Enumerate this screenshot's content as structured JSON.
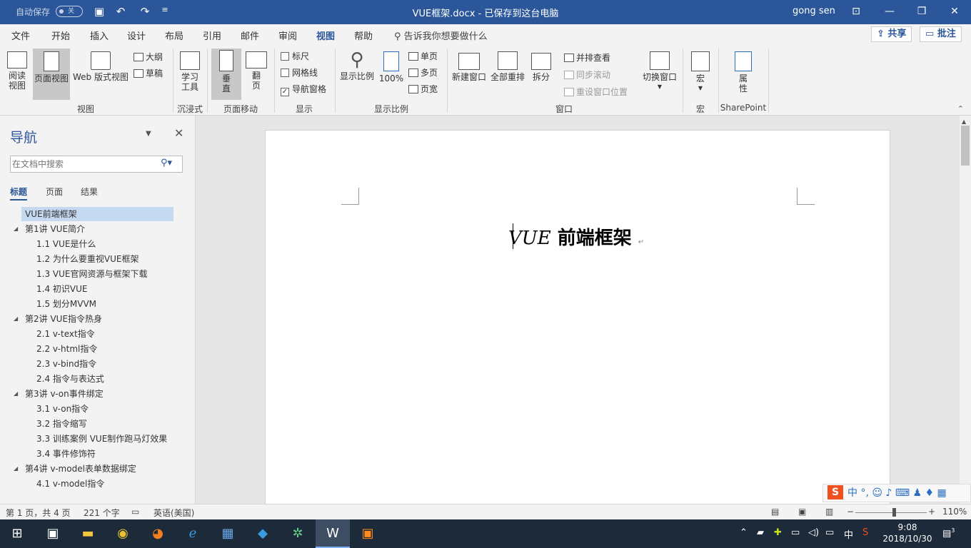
{
  "titlebar": {
    "autosave_label": "自动保存",
    "autosave_state": "关",
    "title": "VUE框架.docx - 已保存到这台电脑",
    "user": "gong sen",
    "qat_icons": [
      "save-icon",
      "undo-icon",
      "redo-icon",
      "customize-icon"
    ]
  },
  "menu": {
    "tabs": [
      "文件",
      "开始",
      "插入",
      "设计",
      "布局",
      "引用",
      "邮件",
      "审阅",
      "视图",
      "帮助"
    ],
    "active_tab": "视图",
    "tellme": "告诉我你想要做什么",
    "share": "共享",
    "comments": "批注"
  },
  "ribbon": {
    "views": {
      "read_mode": "阅读\n视图",
      "print_layout": "页面视图",
      "web_layout": "Web 版式视图",
      "outline": "大纲",
      "draft": "草稿",
      "group": "视图"
    },
    "immersive": {
      "learning_tools": "学习\n工具",
      "group": "沉浸式"
    },
    "page_movement": {
      "vertical": "垂\n直",
      "side_to_side": "翻\n页",
      "group": "页面移动"
    },
    "show": {
      "ruler": "标尺",
      "gridlines": "网格线",
      "nav_pane": "导航窗格",
      "ruler_checked": false,
      "gridlines_checked": false,
      "nav_pane_checked": true,
      "group": "显示"
    },
    "zoom": {
      "zoom": "显示比例",
      "hundred": "100%",
      "one_page": "单页",
      "multi_page": "多页",
      "page_width": "页宽",
      "group": "显示比例"
    },
    "window": {
      "new_window": "新建窗口",
      "arrange_all": "全部重排",
      "split": "拆分",
      "side_by_side": "并排查看",
      "sync_scroll": "同步滚动",
      "reset_position": "重设窗口位置",
      "switch_windows": "切换窗口",
      "group": "窗口"
    },
    "macros": {
      "macros": "宏",
      "group": "宏"
    },
    "sharepoint": {
      "properties": "属\n性",
      "group": "SharePoint"
    }
  },
  "nav": {
    "title": "导航",
    "search_placeholder": "在文档中搜索",
    "tabs": [
      "标题",
      "页面",
      "结果"
    ],
    "active_tab": "标题",
    "headings": [
      {
        "text": "VUE前端框架",
        "level": 0,
        "selected": true
      },
      {
        "text": "第1讲 VUE简介",
        "level": 1,
        "expanded": true
      },
      {
        "text": "1.1 VUE是什么",
        "level": 2
      },
      {
        "text": "1.2 为什么要重视VUE框架",
        "level": 2
      },
      {
        "text": "1.3 VUE官网资源与框架下载",
        "level": 2
      },
      {
        "text": "1.4 初识VUE",
        "level": 2
      },
      {
        "text": "1.5 划分MVVM",
        "level": 2
      },
      {
        "text": "第2讲 VUE指令热身",
        "level": 1,
        "expanded": true
      },
      {
        "text": "2.1 v-text指令",
        "level": 2
      },
      {
        "text": "2.2 v-html指令",
        "level": 2
      },
      {
        "text": "2.3 v-bind指令",
        "level": 2
      },
      {
        "text": "2.4 指令与表达式",
        "level": 2
      },
      {
        "text": "第3讲 v-on事件绑定",
        "level": 1,
        "expanded": true
      },
      {
        "text": "3.1 v-on指令",
        "level": 2
      },
      {
        "text": "3.2 指令缩写",
        "level": 2
      },
      {
        "text": "3.3 训练案例 VUE制作跑马灯效果",
        "level": 2
      },
      {
        "text": "3.4 事件修饰符",
        "level": 2
      },
      {
        "text": "第4讲 v-model表单数据绑定",
        "level": 1,
        "expanded": true
      },
      {
        "text": "4.1 v-model指令",
        "level": 2
      }
    ]
  },
  "document": {
    "heading_latin": "VUE",
    "heading_cjk": "前端框架",
    "para_mark": "↵"
  },
  "ime": {
    "logo": "S",
    "mode": "中",
    "icons": [
      "punctuation-icon",
      "emoji-icon",
      "mic-icon",
      "keyboard-icon",
      "user-icon",
      "skin-icon",
      "toolbox-icon"
    ]
  },
  "status": {
    "page": "第 1 页，共 4 页",
    "words": "221 个字",
    "language": "英语(美国)",
    "zoom_percent": "110%",
    "zoom_level": 0.55
  },
  "taskbar": {
    "apps": [
      "start-icon",
      "explorer-alt-icon",
      "file-explorer-icon",
      "chrome-icon",
      "firefox-icon",
      "ie-icon",
      "film-icon",
      "vscode-icon",
      "atom-icon",
      "word-icon",
      "slides-icon"
    ],
    "active": "word-icon",
    "time": "9:08",
    "date": "2018/10/30",
    "ime_indicator": "中",
    "notifications": "3"
  }
}
